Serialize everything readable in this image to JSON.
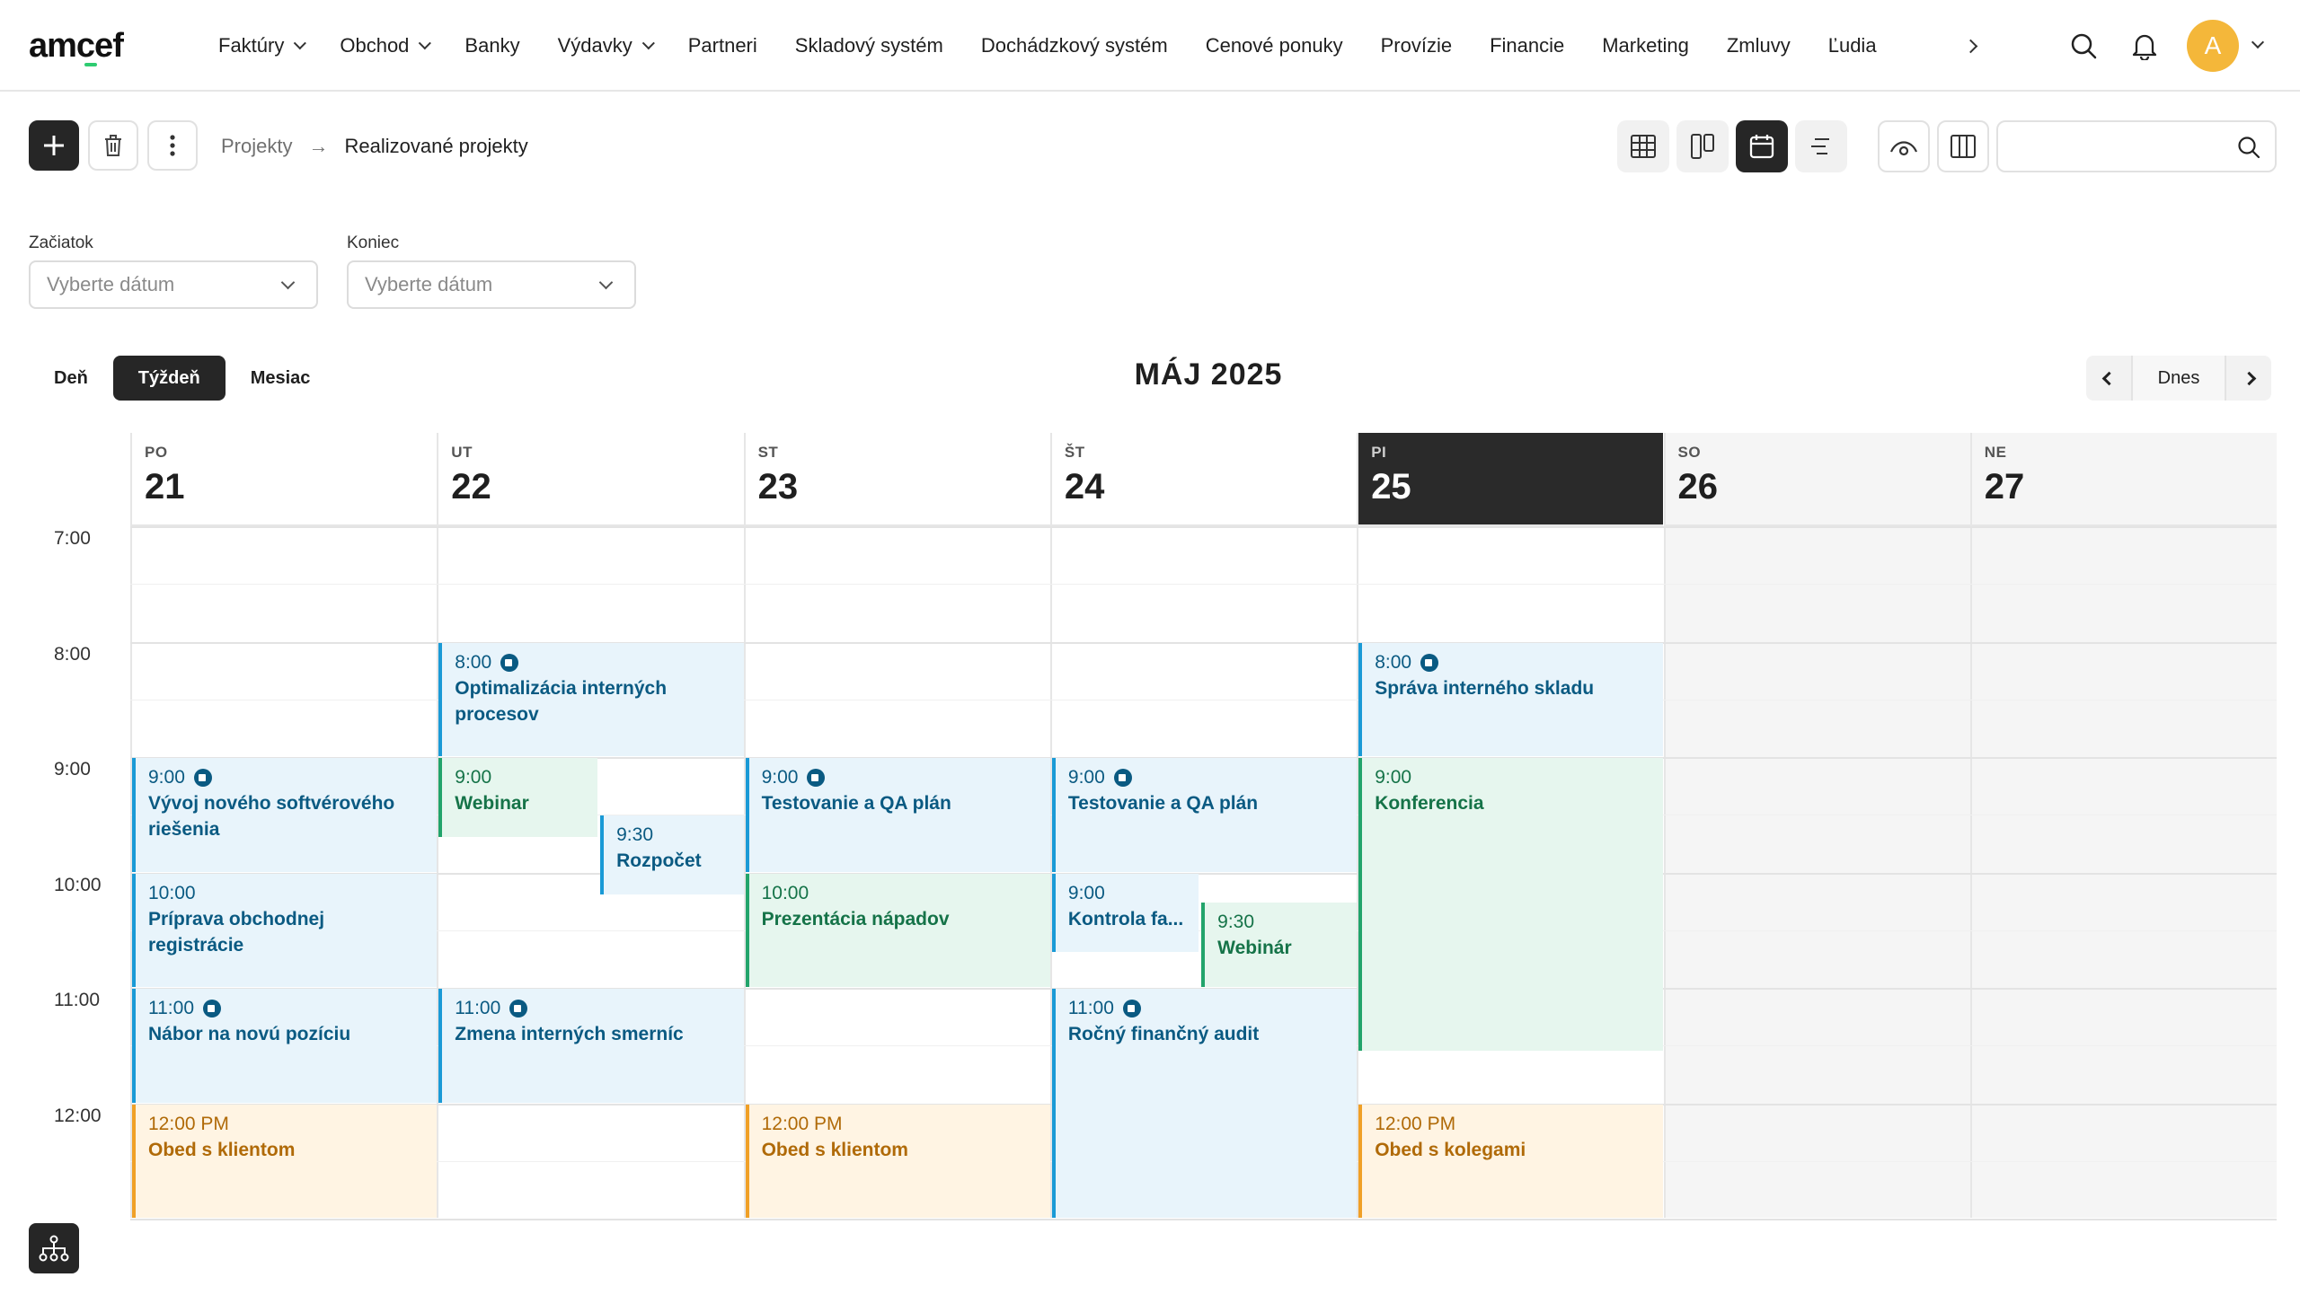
{
  "app": {
    "logo": "amcef"
  },
  "nav": {
    "items": [
      {
        "label": "Faktúry",
        "dropdown": true
      },
      {
        "label": "Obchod",
        "dropdown": true
      },
      {
        "label": "Banky",
        "dropdown": false
      },
      {
        "label": "Výdavky",
        "dropdown": true
      },
      {
        "label": "Partneri",
        "dropdown": false
      },
      {
        "label": "Skladový systém",
        "dropdown": false
      },
      {
        "label": "Dochádzkový systém",
        "dropdown": false
      },
      {
        "label": "Cenové ponuky",
        "dropdown": false
      },
      {
        "label": "Provízie",
        "dropdown": false
      },
      {
        "label": "Financie",
        "dropdown": false
      },
      {
        "label": "Marketing",
        "dropdown": false
      },
      {
        "label": "Zmluvy",
        "dropdown": false
      },
      {
        "label": "Ľudia",
        "dropdown": false
      }
    ],
    "avatar_initial": "A"
  },
  "breadcrumb": {
    "parent": "Projekty",
    "separator": "→",
    "current": "Realizované projekty"
  },
  "search": {
    "placeholder": ""
  },
  "filters": {
    "start": {
      "label": "Začiatok",
      "placeholder": "Vyberte dátum"
    },
    "end": {
      "label": "Koniec",
      "placeholder": "Vyberte dátum"
    }
  },
  "calendar": {
    "views": [
      "Deň",
      "Týždeň",
      "Mesiac"
    ],
    "active_view": "Týždeň",
    "month_title": "MÁJ 2025",
    "today_label": "Dnes",
    "days": [
      {
        "dow": "PO",
        "num": "21",
        "weekend": false,
        "today": false
      },
      {
        "dow": "UT",
        "num": "22",
        "weekend": false,
        "today": false
      },
      {
        "dow": "ST",
        "num": "23",
        "weekend": false,
        "today": false
      },
      {
        "dow": "ŠT",
        "num": "24",
        "weekend": false,
        "today": false
      },
      {
        "dow": "PI",
        "num": "25",
        "weekend": false,
        "today": true
      },
      {
        "dow": "SO",
        "num": "26",
        "weekend": true,
        "today": false
      },
      {
        "dow": "NE",
        "num": "27",
        "weekend": true,
        "today": false
      }
    ],
    "hours": [
      "7:00",
      "8:00",
      "9:00",
      "10:00",
      "11:00",
      "12:00"
    ],
    "events": [
      {
        "day": 0,
        "start": "9:00",
        "time": "9:00",
        "title": "Vývoj nového softvérového riešenia",
        "color": "blue",
        "video": true
      },
      {
        "day": 0,
        "start": "10:00",
        "time": "10:00",
        "title": "Príprava obchodnej registrácie",
        "color": "blue",
        "video": false
      },
      {
        "day": 0,
        "start": "11:00",
        "time": "11:00",
        "title": "Nábor na novú pozíciu",
        "color": "blue",
        "video": true
      },
      {
        "day": 0,
        "start": "12:00",
        "time": "12:00 PM",
        "title": "Obed s klientom",
        "color": "orange",
        "video": false
      },
      {
        "day": 1,
        "start": "8:00",
        "time": "8:00",
        "title": "Optimalizácia interných procesov",
        "color": "blue",
        "video": true
      },
      {
        "day": 1,
        "start": "9:00",
        "time": "9:00",
        "title": "Webinar",
        "color": "green",
        "video": false
      },
      {
        "day": 1,
        "start": "9:30",
        "time": "9:30",
        "title": "Rozpočet",
        "color": "blue",
        "video": false
      },
      {
        "day": 1,
        "start": "11:00",
        "time": "11:00",
        "title": "Zmena interných smerníc",
        "color": "blue",
        "video": true
      },
      {
        "day": 2,
        "start": "9:00",
        "time": "9:00",
        "title": "Testovanie a QA plán",
        "color": "blue",
        "video": true
      },
      {
        "day": 2,
        "start": "10:00",
        "time": "10:00",
        "title": "Prezentácia nápadov",
        "color": "green",
        "video": false
      },
      {
        "day": 2,
        "start": "12:00",
        "time": "12:00 PM",
        "title": "Obed s klientom",
        "color": "orange",
        "video": false
      },
      {
        "day": 3,
        "start": "9:00",
        "time": "9:00",
        "title": "Testovanie a QA plán",
        "color": "blue",
        "video": true
      },
      {
        "day": 3,
        "start": "10:00",
        "time": "9:00",
        "title": "Kontrola fa...",
        "color": "blue",
        "video": false
      },
      {
        "day": 3,
        "start": "10:15",
        "time": "9:30",
        "title": "Webinár",
        "color": "green",
        "video": false
      },
      {
        "day": 3,
        "start": "11:00",
        "time": "11:00",
        "title": "Ročný finančný audit",
        "color": "blue",
        "video": true
      },
      {
        "day": 4,
        "start": "8:00",
        "time": "8:00",
        "title": "Správa interného skladu",
        "color": "blue",
        "video": true
      },
      {
        "day": 4,
        "start": "9:00",
        "time": "9:00",
        "title": "Konferencia",
        "color": "green",
        "video": false
      },
      {
        "day": 4,
        "start": "12:00",
        "time": "12:00 PM",
        "title": "Obed s kolegami",
        "color": "orange",
        "video": false
      }
    ]
  },
  "colors": {
    "accent_dark": "#262626",
    "avatar": "#f4b73a",
    "event_blue": "#1a9ad6",
    "event_green": "#22a46b",
    "event_orange": "#f0a027"
  }
}
